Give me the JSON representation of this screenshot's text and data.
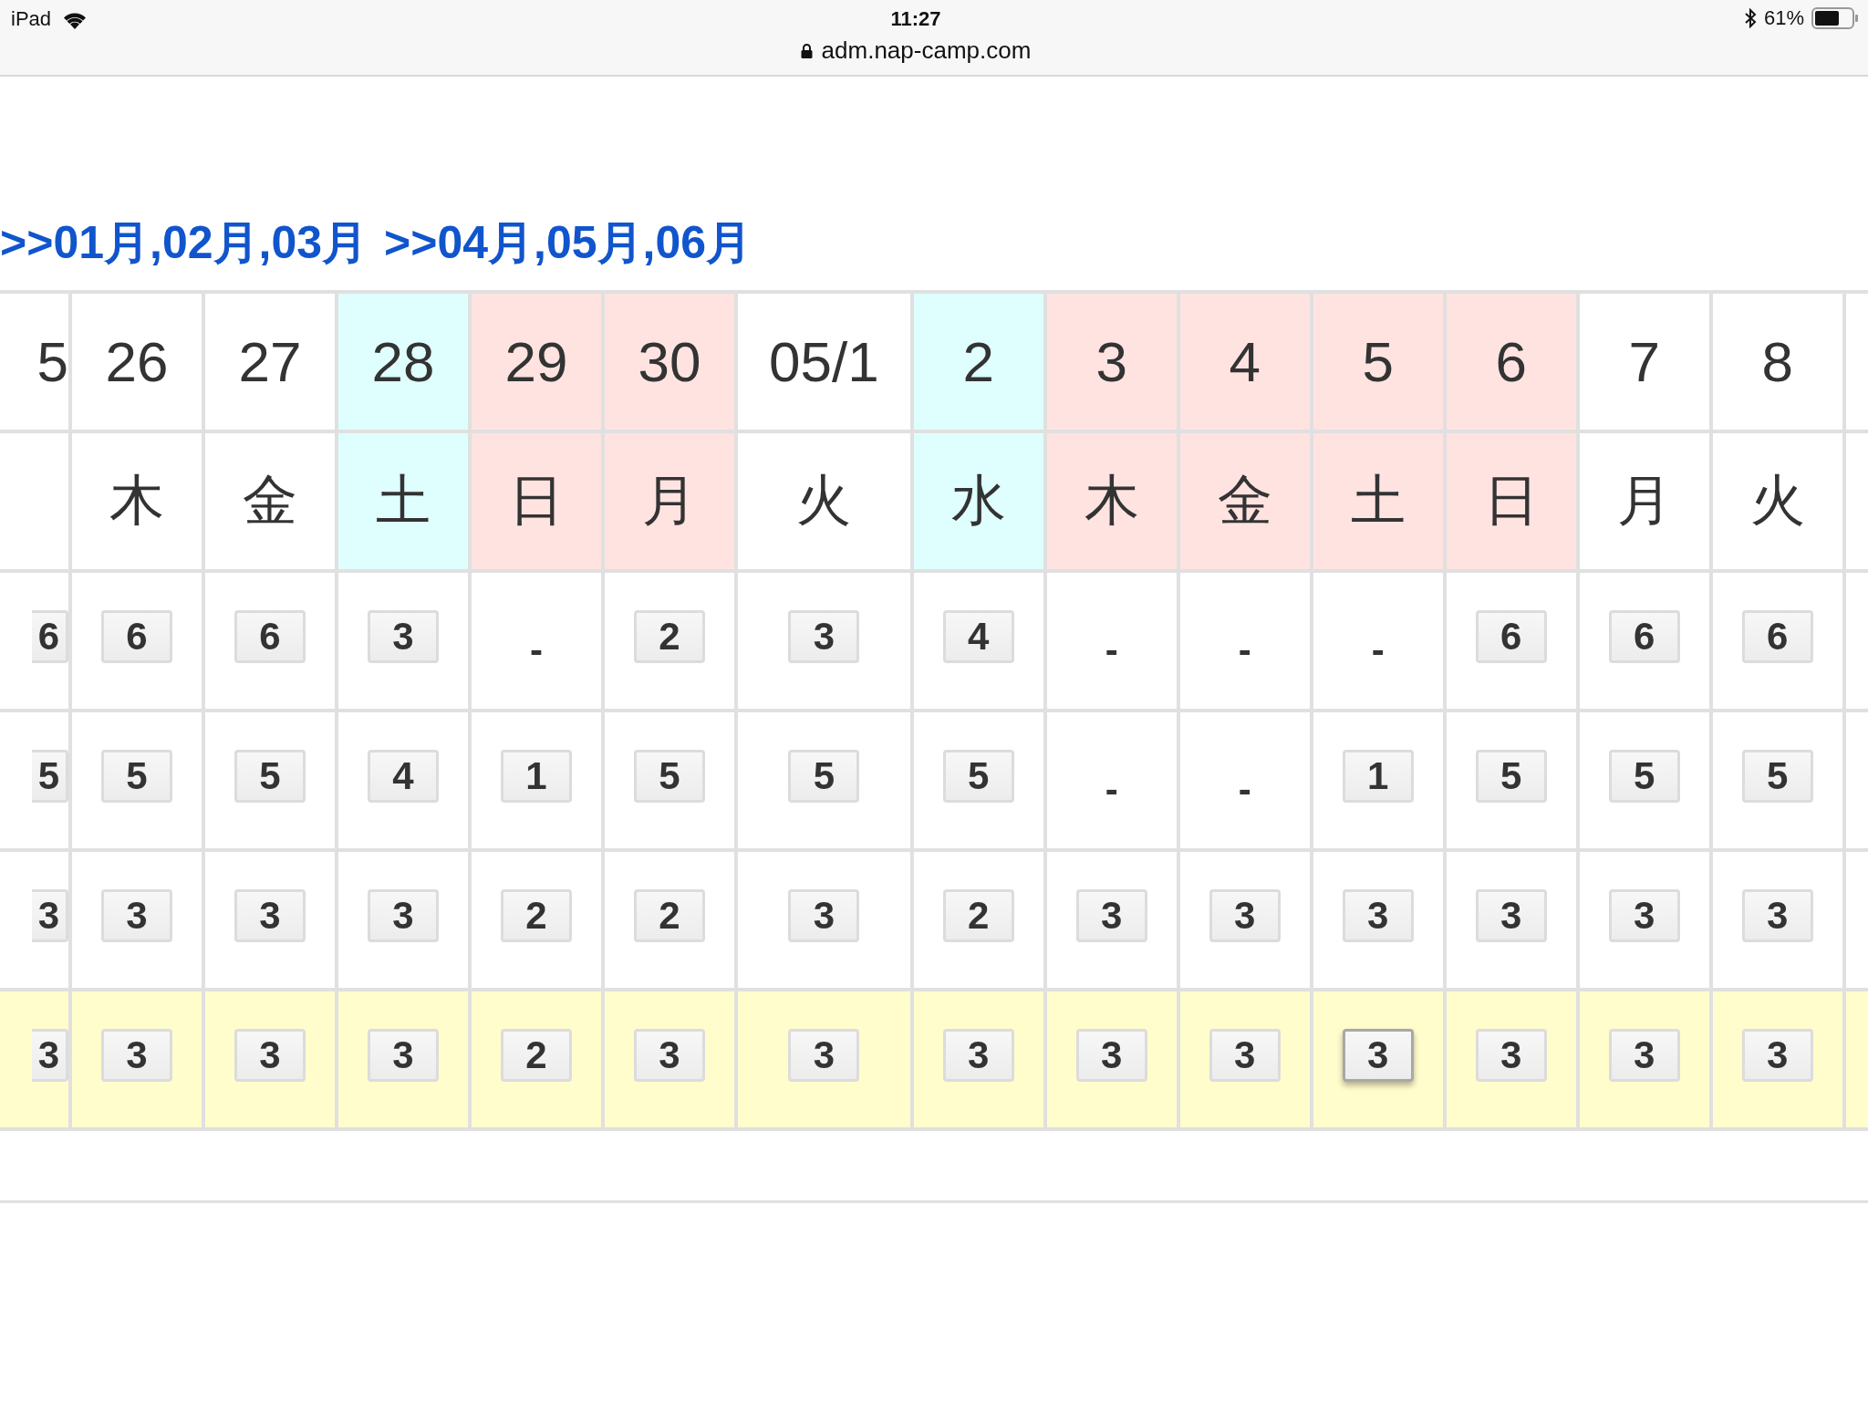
{
  "status_bar": {
    "device": "iPad",
    "time": "11:27",
    "url": "adm.nap-camp.com",
    "battery": "61%"
  },
  "month_links": [
    ">>01月,02月,03月",
    ">>04月,05月,06月"
  ],
  "count_rows": [
    {
      "highlighted": false
    },
    {
      "highlighted": false
    },
    {
      "highlighted": false
    },
    {
      "highlighted": true
    }
  ],
  "cut_column": {
    "day": "5",
    "counts": [
      "6",
      "5",
      "3",
      "3"
    ]
  },
  "columns": [
    {
      "day": "26",
      "weekday": "木",
      "color": "#ffffff",
      "counts": [
        {
          "value": "6",
          "kind": "button",
          "focused": false
        },
        {
          "value": "5",
          "kind": "button",
          "focused": false
        },
        {
          "value": "3",
          "kind": "button",
          "focused": false
        },
        {
          "value": "3",
          "kind": "button",
          "focused": false
        }
      ]
    },
    {
      "day": "27",
      "weekday": "金",
      "color": "#ffffff",
      "counts": [
        {
          "value": "6",
          "kind": "button",
          "focused": false
        },
        {
          "value": "5",
          "kind": "button",
          "focused": false
        },
        {
          "value": "3",
          "kind": "button",
          "focused": false
        },
        {
          "value": "3",
          "kind": "button",
          "focused": false
        }
      ]
    },
    {
      "day": "28",
      "weekday": "土",
      "color": "#dfffff",
      "counts": [
        {
          "value": "3",
          "kind": "button",
          "focused": false
        },
        {
          "value": "4",
          "kind": "button",
          "focused": false
        },
        {
          "value": "3",
          "kind": "button",
          "focused": false
        },
        {
          "value": "3",
          "kind": "button",
          "focused": false
        }
      ]
    },
    {
      "day": "29",
      "weekday": "日",
      "color": "#ffe3e1",
      "counts": [
        {
          "value": "-",
          "kind": "none"
        },
        {
          "value": "1",
          "kind": "button",
          "focused": false
        },
        {
          "value": "2",
          "kind": "button",
          "focused": false
        },
        {
          "value": "2",
          "kind": "button",
          "focused": false
        }
      ]
    },
    {
      "day": "30",
      "weekday": "月",
      "color": "#ffe3e1",
      "counts": [
        {
          "value": "2",
          "kind": "button",
          "focused": false
        },
        {
          "value": "5",
          "kind": "button",
          "focused": false
        },
        {
          "value": "2",
          "kind": "button",
          "focused": false
        },
        {
          "value": "3",
          "kind": "button",
          "focused": false
        }
      ]
    },
    {
      "day": "05/1",
      "weekday": "火",
      "color": "#ffffff",
      "counts": [
        {
          "value": "3",
          "kind": "button",
          "focused": false
        },
        {
          "value": "5",
          "kind": "button",
          "focused": false
        },
        {
          "value": "3",
          "kind": "button",
          "focused": false
        },
        {
          "value": "3",
          "kind": "button",
          "focused": false
        }
      ]
    },
    {
      "day": "2",
      "weekday": "水",
      "color": "#dfffff",
      "counts": [
        {
          "value": "4",
          "kind": "button",
          "focused": false
        },
        {
          "value": "5",
          "kind": "button",
          "focused": false
        },
        {
          "value": "2",
          "kind": "button",
          "focused": false
        },
        {
          "value": "3",
          "kind": "button",
          "focused": false
        }
      ]
    },
    {
      "day": "3",
      "weekday": "木",
      "color": "#ffe3e1",
      "counts": [
        {
          "value": "-",
          "kind": "none"
        },
        {
          "value": "-",
          "kind": "none"
        },
        {
          "value": "3",
          "kind": "button",
          "focused": false
        },
        {
          "value": "3",
          "kind": "button",
          "focused": false
        }
      ]
    },
    {
      "day": "4",
      "weekday": "金",
      "color": "#ffe3e1",
      "counts": [
        {
          "value": "-",
          "kind": "none"
        },
        {
          "value": "-",
          "kind": "none"
        },
        {
          "value": "3",
          "kind": "button",
          "focused": false
        },
        {
          "value": "3",
          "kind": "button",
          "focused": false
        }
      ]
    },
    {
      "day": "5",
      "weekday": "土",
      "color": "#ffe3e1",
      "counts": [
        {
          "value": "-",
          "kind": "none"
        },
        {
          "value": "1",
          "kind": "button",
          "focused": false
        },
        {
          "value": "3",
          "kind": "button",
          "focused": false
        },
        {
          "value": "3",
          "kind": "button",
          "focused": true
        }
      ]
    },
    {
      "day": "6",
      "weekday": "日",
      "color": "#ffe3e1",
      "counts": [
        {
          "value": "6",
          "kind": "button",
          "focused": false
        },
        {
          "value": "5",
          "kind": "button",
          "focused": false
        },
        {
          "value": "3",
          "kind": "button",
          "focused": false
        },
        {
          "value": "3",
          "kind": "button",
          "focused": false
        }
      ]
    },
    {
      "day": "7",
      "weekday": "月",
      "color": "#ffffff",
      "counts": [
        {
          "value": "6",
          "kind": "button",
          "focused": false
        },
        {
          "value": "5",
          "kind": "button",
          "focused": false
        },
        {
          "value": "3",
          "kind": "button",
          "focused": false
        },
        {
          "value": "3",
          "kind": "button",
          "focused": false
        }
      ]
    },
    {
      "day": "8",
      "weekday": "火",
      "color": "#ffffff",
      "counts": [
        {
          "value": "6",
          "kind": "button",
          "focused": false
        },
        {
          "value": "5",
          "kind": "button",
          "focused": false
        },
        {
          "value": "3",
          "kind": "button",
          "focused": false
        },
        {
          "value": "3",
          "kind": "button",
          "focused": false
        }
      ]
    }
  ]
}
